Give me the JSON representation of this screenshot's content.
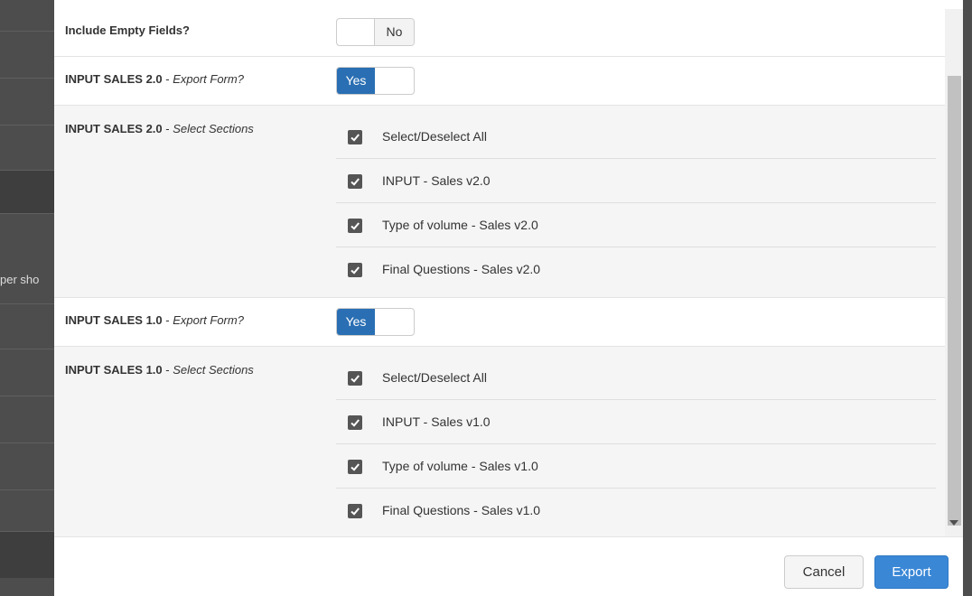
{
  "background": {
    "partial_text": "per sho"
  },
  "include_empty": {
    "label": "Include Empty Fields?",
    "toggle_value": "No"
  },
  "sales2": {
    "export_label_bold": "INPUT SALES 2.0",
    "export_label_italic": "Export Form?",
    "toggle_value": "Yes",
    "sections_label_bold": "INPUT SALES 2.0",
    "sections_label_italic": "Select Sections",
    "items": [
      {
        "label": "Select/Deselect All",
        "checked": true
      },
      {
        "label": "INPUT - Sales v2.0",
        "checked": true
      },
      {
        "label": "Type of volume - Sales v2.0",
        "checked": true
      },
      {
        "label": "Final Questions - Sales v2.0",
        "checked": true
      }
    ]
  },
  "sales1": {
    "export_label_bold": "INPUT SALES 1.0",
    "export_label_italic": "Export Form?",
    "toggle_value": "Yes",
    "sections_label_bold": "INPUT SALES 1.0",
    "sections_label_italic": "Select Sections",
    "items": [
      {
        "label": "Select/Deselect All",
        "checked": true
      },
      {
        "label": "INPUT - Sales v1.0",
        "checked": true
      },
      {
        "label": "Type of volume - Sales v1.0",
        "checked": true
      },
      {
        "label": "Final Questions - Sales v1.0",
        "checked": true
      }
    ]
  },
  "footer": {
    "cancel_label": "Cancel",
    "export_label": "Export"
  },
  "colors": {
    "toggle_on": "#2a6fb3",
    "export_button": "#3a87d6"
  }
}
